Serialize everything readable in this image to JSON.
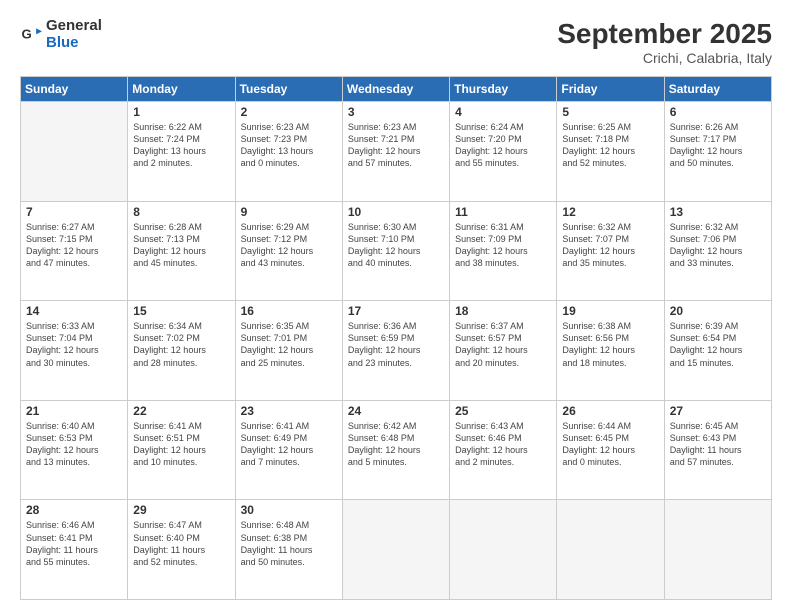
{
  "header": {
    "logo_general": "General",
    "logo_blue": "Blue",
    "month_title": "September 2025",
    "subtitle": "Crichi, Calabria, Italy"
  },
  "weekdays": [
    "Sunday",
    "Monday",
    "Tuesday",
    "Wednesday",
    "Thursday",
    "Friday",
    "Saturday"
  ],
  "weeks": [
    [
      {
        "day": "",
        "info": ""
      },
      {
        "day": "1",
        "info": "Sunrise: 6:22 AM\nSunset: 7:24 PM\nDaylight: 13 hours\nand 2 minutes."
      },
      {
        "day": "2",
        "info": "Sunrise: 6:23 AM\nSunset: 7:23 PM\nDaylight: 13 hours\nand 0 minutes."
      },
      {
        "day": "3",
        "info": "Sunrise: 6:23 AM\nSunset: 7:21 PM\nDaylight: 12 hours\nand 57 minutes."
      },
      {
        "day": "4",
        "info": "Sunrise: 6:24 AM\nSunset: 7:20 PM\nDaylight: 12 hours\nand 55 minutes."
      },
      {
        "day": "5",
        "info": "Sunrise: 6:25 AM\nSunset: 7:18 PM\nDaylight: 12 hours\nand 52 minutes."
      },
      {
        "day": "6",
        "info": "Sunrise: 6:26 AM\nSunset: 7:17 PM\nDaylight: 12 hours\nand 50 minutes."
      }
    ],
    [
      {
        "day": "7",
        "info": "Sunrise: 6:27 AM\nSunset: 7:15 PM\nDaylight: 12 hours\nand 47 minutes."
      },
      {
        "day": "8",
        "info": "Sunrise: 6:28 AM\nSunset: 7:13 PM\nDaylight: 12 hours\nand 45 minutes."
      },
      {
        "day": "9",
        "info": "Sunrise: 6:29 AM\nSunset: 7:12 PM\nDaylight: 12 hours\nand 43 minutes."
      },
      {
        "day": "10",
        "info": "Sunrise: 6:30 AM\nSunset: 7:10 PM\nDaylight: 12 hours\nand 40 minutes."
      },
      {
        "day": "11",
        "info": "Sunrise: 6:31 AM\nSunset: 7:09 PM\nDaylight: 12 hours\nand 38 minutes."
      },
      {
        "day": "12",
        "info": "Sunrise: 6:32 AM\nSunset: 7:07 PM\nDaylight: 12 hours\nand 35 minutes."
      },
      {
        "day": "13",
        "info": "Sunrise: 6:32 AM\nSunset: 7:06 PM\nDaylight: 12 hours\nand 33 minutes."
      }
    ],
    [
      {
        "day": "14",
        "info": "Sunrise: 6:33 AM\nSunset: 7:04 PM\nDaylight: 12 hours\nand 30 minutes."
      },
      {
        "day": "15",
        "info": "Sunrise: 6:34 AM\nSunset: 7:02 PM\nDaylight: 12 hours\nand 28 minutes."
      },
      {
        "day": "16",
        "info": "Sunrise: 6:35 AM\nSunset: 7:01 PM\nDaylight: 12 hours\nand 25 minutes."
      },
      {
        "day": "17",
        "info": "Sunrise: 6:36 AM\nSunset: 6:59 PM\nDaylight: 12 hours\nand 23 minutes."
      },
      {
        "day": "18",
        "info": "Sunrise: 6:37 AM\nSunset: 6:57 PM\nDaylight: 12 hours\nand 20 minutes."
      },
      {
        "day": "19",
        "info": "Sunrise: 6:38 AM\nSunset: 6:56 PM\nDaylight: 12 hours\nand 18 minutes."
      },
      {
        "day": "20",
        "info": "Sunrise: 6:39 AM\nSunset: 6:54 PM\nDaylight: 12 hours\nand 15 minutes."
      }
    ],
    [
      {
        "day": "21",
        "info": "Sunrise: 6:40 AM\nSunset: 6:53 PM\nDaylight: 12 hours\nand 13 minutes."
      },
      {
        "day": "22",
        "info": "Sunrise: 6:41 AM\nSunset: 6:51 PM\nDaylight: 12 hours\nand 10 minutes."
      },
      {
        "day": "23",
        "info": "Sunrise: 6:41 AM\nSunset: 6:49 PM\nDaylight: 12 hours\nand 7 minutes."
      },
      {
        "day": "24",
        "info": "Sunrise: 6:42 AM\nSunset: 6:48 PM\nDaylight: 12 hours\nand 5 minutes."
      },
      {
        "day": "25",
        "info": "Sunrise: 6:43 AM\nSunset: 6:46 PM\nDaylight: 12 hours\nand 2 minutes."
      },
      {
        "day": "26",
        "info": "Sunrise: 6:44 AM\nSunset: 6:45 PM\nDaylight: 12 hours\nand 0 minutes."
      },
      {
        "day": "27",
        "info": "Sunrise: 6:45 AM\nSunset: 6:43 PM\nDaylight: 11 hours\nand 57 minutes."
      }
    ],
    [
      {
        "day": "28",
        "info": "Sunrise: 6:46 AM\nSunset: 6:41 PM\nDaylight: 11 hours\nand 55 minutes."
      },
      {
        "day": "29",
        "info": "Sunrise: 6:47 AM\nSunset: 6:40 PM\nDaylight: 11 hours\nand 52 minutes."
      },
      {
        "day": "30",
        "info": "Sunrise: 6:48 AM\nSunset: 6:38 PM\nDaylight: 11 hours\nand 50 minutes."
      },
      {
        "day": "",
        "info": ""
      },
      {
        "day": "",
        "info": ""
      },
      {
        "day": "",
        "info": ""
      },
      {
        "day": "",
        "info": ""
      }
    ]
  ]
}
